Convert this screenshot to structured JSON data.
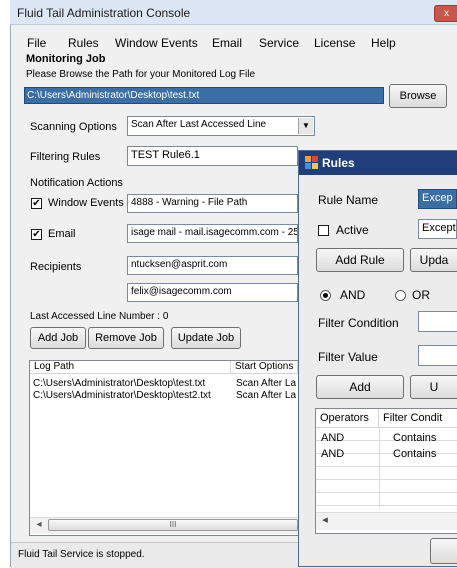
{
  "window": {
    "title": "Fluid Tail Administration Console",
    "close_glyph": "x"
  },
  "menu": [
    "File",
    "Rules",
    "Window Events",
    "Email",
    "Service",
    "License",
    "Help"
  ],
  "monitoring": {
    "heading": "Monitoring Job",
    "browse_prompt": "Please Browse the Path for your Monitored Log File",
    "path": "C:\\Users\\Administrator\\Desktop\\test.txt",
    "browse_label": "Browse"
  },
  "scanning": {
    "label": "Scanning Options",
    "value": "Scan After Last Accessed Line"
  },
  "filtering": {
    "label": "Filtering Rules",
    "value": "TEST Rule6.1"
  },
  "notifications": {
    "label": "Notification Actions",
    "window_events": {
      "label": "Window Events",
      "value": "4888 - Warning - File Path",
      "check": "✔"
    },
    "email": {
      "label": "Email",
      "value": "isage mail - mail.isagecomm.com - 25",
      "check": "✔"
    }
  },
  "recipients": {
    "label": "Recipients",
    "values": [
      "ntucksen@asprit.com",
      "felix@isagecomm.com"
    ]
  },
  "last_line": "Last Accessed Line Number : 0",
  "job_buttons": {
    "add": "Add Job",
    "remove": "Remove Job",
    "update": "Update Job"
  },
  "jobs_table": {
    "columns": [
      "Log Path",
      "Start Options"
    ],
    "rows": [
      [
        "C:\\Users\\Administrator\\Desktop\\test.txt",
        "Scan After La"
      ],
      [
        "C:\\Users\\Administrator\\Desktop\\test2.txt",
        "Scan After La"
      ]
    ],
    "scroll_left": "◂",
    "scroll_thumb": "III"
  },
  "status": "Fluid Tail Service is stopped.",
  "rules_dialog": {
    "title": "Rules",
    "rule_name_label": "Rule Name",
    "rule_name_value": "Excep",
    "active_label": "Active",
    "active_field": "Except",
    "add_rule": "Add Rule",
    "update_rule": "Upda",
    "and_label": "AND",
    "or_label": "OR",
    "filter_condition_label": "Filter Condition",
    "filter_value_label": "Filter Value",
    "add_label": "Add",
    "second_button": "U",
    "table": {
      "columns": [
        "Operators",
        "Filter Condit"
      ],
      "rows": [
        [
          "AND",
          "Contains"
        ],
        [
          "AND",
          "Contains"
        ]
      ],
      "scroll_left": "◂"
    }
  },
  "colors": {
    "title_blue": "#203e7c",
    "selection": "#3a6ea5"
  }
}
